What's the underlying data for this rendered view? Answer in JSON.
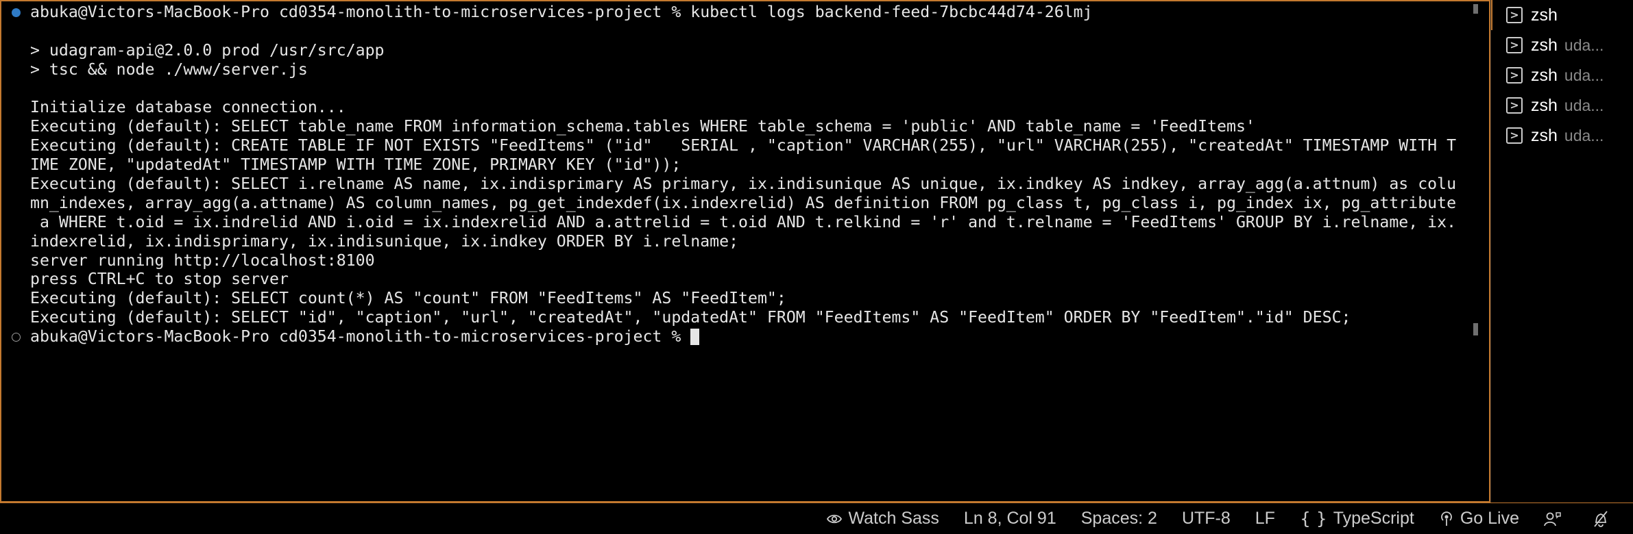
{
  "terminal": {
    "lines": [
      {
        "marker": "filled",
        "text": "abuka@Victors-MacBook-Pro cd0354-monolith-to-microservices-project % kubectl logs backend-feed-7bcbc44d74-26lmj"
      },
      {
        "marker": "",
        "text": ""
      },
      {
        "marker": "",
        "text": "> udagram-api@2.0.0 prod /usr/src/app"
      },
      {
        "marker": "",
        "text": "> tsc && node ./www/server.js"
      },
      {
        "marker": "",
        "text": ""
      },
      {
        "marker": "",
        "text": "Initialize database connection..."
      },
      {
        "marker": "",
        "text": "Executing (default): SELECT table_name FROM information_schema.tables WHERE table_schema = 'public' AND table_name = 'FeedItems'"
      },
      {
        "marker": "",
        "text": "Executing (default): CREATE TABLE IF NOT EXISTS \"FeedItems\" (\"id\"   SERIAL , \"caption\" VARCHAR(255), \"url\" VARCHAR(255), \"createdAt\" TIMESTAMP WITH T"
      },
      {
        "marker": "",
        "text": "IME ZONE, \"updatedAt\" TIMESTAMP WITH TIME ZONE, PRIMARY KEY (\"id\"));"
      },
      {
        "marker": "",
        "text": "Executing (default): SELECT i.relname AS name, ix.indisprimary AS primary, ix.indisunique AS unique, ix.indkey AS indkey, array_agg(a.attnum) as colu"
      },
      {
        "marker": "",
        "text": "mn_indexes, array_agg(a.attname) AS column_names, pg_get_indexdef(ix.indexrelid) AS definition FROM pg_class t, pg_class i, pg_index ix, pg_attribute"
      },
      {
        "marker": "",
        "text": " a WHERE t.oid = ix.indrelid AND i.oid = ix.indexrelid AND a.attrelid = t.oid AND t.relkind = 'r' and t.relname = 'FeedItems' GROUP BY i.relname, ix."
      },
      {
        "marker": "",
        "text": "indexrelid, ix.indisprimary, ix.indisunique, ix.indkey ORDER BY i.relname;"
      },
      {
        "marker": "",
        "text": "server running http://localhost:8100"
      },
      {
        "marker": "",
        "text": "press CTRL+C to stop server"
      },
      {
        "marker": "",
        "text": "Executing (default): SELECT count(*) AS \"count\" FROM \"FeedItems\" AS \"FeedItem\";"
      },
      {
        "marker": "",
        "text": "Executing (default): SELECT \"id\", \"caption\", \"url\", \"createdAt\", \"updatedAt\" FROM \"FeedItems\" AS \"FeedItem\" ORDER BY \"FeedItem\".\"id\" DESC;"
      },
      {
        "marker": "hollow",
        "text": "abuka@Victors-MacBook-Pro cd0354-monolith-to-microservices-project % ",
        "cursor": true
      }
    ]
  },
  "sidebar": {
    "tabs": [
      {
        "name": "zsh",
        "desc": "",
        "active": true
      },
      {
        "name": "zsh",
        "desc": "uda...",
        "active": false
      },
      {
        "name": "zsh",
        "desc": "uda...",
        "active": false
      },
      {
        "name": "zsh",
        "desc": "uda...",
        "active": false
      },
      {
        "name": "zsh",
        "desc": "uda...",
        "active": false
      }
    ]
  },
  "status_bar": {
    "watch_sass": "Watch Sass",
    "cursor_position": "Ln 8, Col 91",
    "spaces": "Spaces: 2",
    "encoding": "UTF-8",
    "eol": "LF",
    "language": "TypeScript",
    "language_icon": "{ }",
    "go_live": "Go Live"
  },
  "colors": {
    "accent_border": "#c3792f",
    "marker_blue": "#2f7bc6",
    "text": "#e6e6e6"
  }
}
